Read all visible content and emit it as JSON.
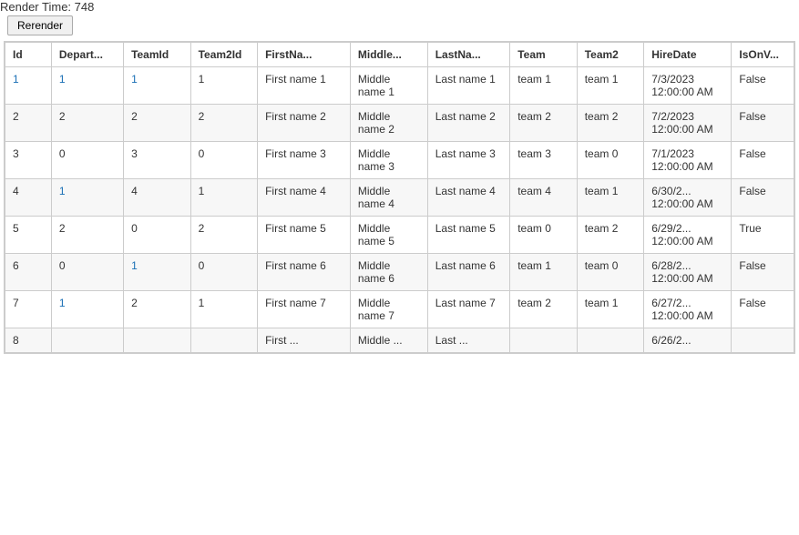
{
  "render_info": {
    "label": "Render Time: 748",
    "rerender_button": "Rerender"
  },
  "columns": [
    {
      "key": "id",
      "label": "Id"
    },
    {
      "key": "depart",
      "label": "Depart..."
    },
    {
      "key": "teamId",
      "label": "TeamId"
    },
    {
      "key": "team2Id",
      "label": "Team2Id"
    },
    {
      "key": "firstName",
      "label": "FirstNa..."
    },
    {
      "key": "middle",
      "label": "Middle..."
    },
    {
      "key": "lastName",
      "label": "LastNa..."
    },
    {
      "key": "team",
      "label": "Team"
    },
    {
      "key": "team2",
      "label": "Team2"
    },
    {
      "key": "hireDate",
      "label": "HireDate"
    },
    {
      "key": "isOnV",
      "label": "IsOnV..."
    }
  ],
  "rows": [
    {
      "id": "1",
      "id_link": true,
      "depart": "1",
      "depart_link": true,
      "teamId": "1",
      "teamId_link": true,
      "team2Id": "1",
      "firstName": "First name 1",
      "middle": "Middle name 1",
      "lastName": "Last name 1",
      "team": "team 1",
      "team2": "team 1",
      "hireDate": "7/3/2023 12:00:00 AM",
      "isOnV": "False"
    },
    {
      "id": "2",
      "id_link": false,
      "depart": "2",
      "depart_link": false,
      "teamId": "2",
      "teamId_link": false,
      "team2Id": "2",
      "firstName": "First name 2",
      "middle": "Middle name 2",
      "lastName": "Last name 2",
      "team": "team 2",
      "team2": "team 2",
      "hireDate": "7/2/2023 12:00:00 AM",
      "isOnV": "False"
    },
    {
      "id": "3",
      "id_link": false,
      "depart": "0",
      "depart_link": false,
      "teamId": "3",
      "teamId_link": false,
      "team2Id": "0",
      "firstName": "First name 3",
      "middle": "Middle name 3",
      "lastName": "Last name 3",
      "team": "team 3",
      "team2": "team 0",
      "hireDate": "7/1/2023 12:00:00 AM",
      "isOnV": "False"
    },
    {
      "id": "4",
      "id_link": false,
      "depart": "1",
      "depart_link": true,
      "teamId": "4",
      "teamId_link": false,
      "team2Id": "1",
      "firstName": "First name 4",
      "middle": "Middle name 4",
      "lastName": "Last name 4",
      "team": "team 4",
      "team2": "team 1",
      "hireDate": "6/30/2... 12:00:00 AM",
      "isOnV": "False"
    },
    {
      "id": "5",
      "id_link": false,
      "depart": "2",
      "depart_link": false,
      "teamId": "0",
      "teamId_link": false,
      "team2Id": "2",
      "firstName": "First name 5",
      "middle": "Middle name 5",
      "lastName": "Last name 5",
      "team": "team 0",
      "team2": "team 2",
      "hireDate": "6/29/2... 12:00:00 AM",
      "isOnV": "True"
    },
    {
      "id": "6",
      "id_link": false,
      "depart": "0",
      "depart_link": false,
      "teamId": "1",
      "teamId_link": true,
      "team2Id": "0",
      "firstName": "First name 6",
      "middle": "Middle name 6",
      "lastName": "Last name 6",
      "team": "team 1",
      "team2": "team 0",
      "hireDate": "6/28/2... 12:00:00 AM",
      "isOnV": "False"
    },
    {
      "id": "7",
      "id_link": false,
      "depart": "1",
      "depart_link": true,
      "teamId": "2",
      "teamId_link": false,
      "team2Id": "1",
      "firstName": "First name 7",
      "middle": "Middle name 7",
      "lastName": "Last name 7",
      "team": "team 2",
      "team2": "team 1",
      "hireDate": "6/27/2... 12:00:00 AM",
      "isOnV": "False"
    },
    {
      "id": "8",
      "id_link": false,
      "depart": "",
      "depart_link": false,
      "teamId": "",
      "teamId_link": false,
      "team2Id": "",
      "firstName": "First ...",
      "middle": "Middle ...",
      "lastName": "Last ...",
      "team": "",
      "team2": "",
      "hireDate": "6/26/2...",
      "isOnV": ""
    }
  ]
}
